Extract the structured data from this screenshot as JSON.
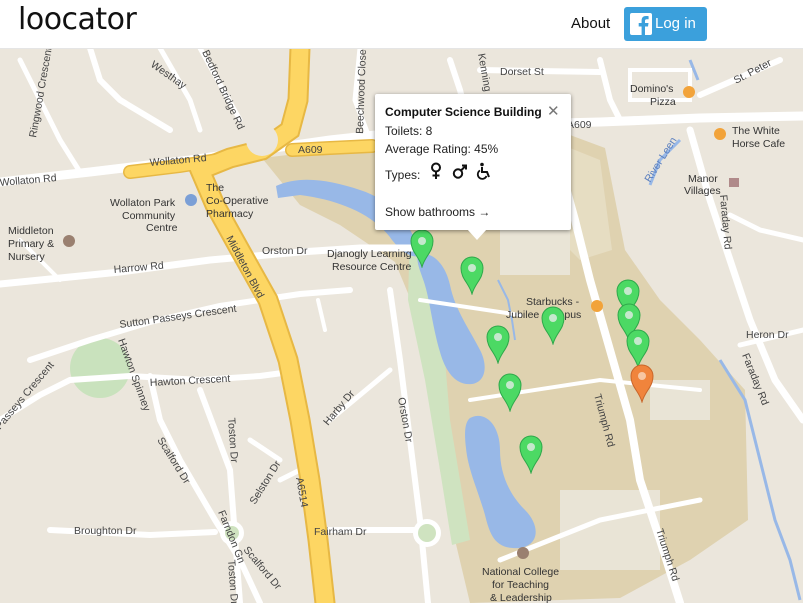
{
  "header": {
    "logo": "loocator",
    "about_label": "About",
    "login_label": "Log in",
    "facebook_glyph": "f"
  },
  "popup": {
    "title": "Computer Science Building",
    "close_glyph": "✕",
    "toilets_text": "Toilets: 8",
    "rating_text": "Average Rating: 45%",
    "types_label": "Types:",
    "types": [
      "female-icon",
      "male-icon",
      "wheelchair-icon"
    ],
    "link_text": "Show bathrooms →"
  },
  "markers": {
    "colors": {
      "default": "#4cd964",
      "selected": "#f0843c"
    },
    "count": 11
  },
  "map": {
    "roads": {
      "westhay": "Westhay",
      "bedford_bridge": "Bedford Bridge Rd",
      "ringwood": "Ringwood Crescent",
      "beechwood": "Beechwood Close",
      "kenmore": "Kenning",
      "dorset": "Dorset St",
      "st_peter": "St. Peter",
      "a609_right": "A609",
      "wollaton_rd_1": "Wollaton Rd",
      "wollaton_rd_2": "Wollaton Rd",
      "a609_left": "A609",
      "middleton_blvd": "Middleton Blvd",
      "orston_dr_1": "Orston Dr",
      "harrow_rd": "Harrow Rd",
      "sutton_passeys": "Sutton Passeys Crescent",
      "hawton_spinney": "Hawton Spinney",
      "hawton_crescent": "Hawton Crescent",
      "passeys_crescent": "Passeys Crescent",
      "harby_dr": "Harby Dr",
      "orston_dr_2": "Orston Dr",
      "scalford_dr_1": "Scalford Dr",
      "toston_dr_1": "Toston Dr",
      "selston_dr": "Selston Dr",
      "a6514": "A6514",
      "broughton_dr": "Broughton Dr",
      "fairham_dr": "Fairham Dr",
      "farndon_gn": "Farndon Gn",
      "scalford_dr_2": "Scalford Dr",
      "toston_dr_2": "Toston Dr",
      "triumph_rd_1": "Triumph Rd",
      "triumph_rd_2": "Triumph Rd",
      "faraday_rd_1": "Faraday Rd",
      "faraday_rd_2": "Faraday Rd",
      "heron_dr": "Heron Dr",
      "river_leen": "River Leen"
    },
    "pois": {
      "dominos": [
        "Domino's",
        "Pizza"
      ],
      "white_horse": [
        "The White",
        "Horse Cafe"
      ],
      "manor_villages": [
        "Manor",
        "Villages"
      ],
      "wollaton_park_school": [
        "Wollaton Park",
        "Community",
        "Centre"
      ],
      "middleton_school": [
        "Middleton",
        "Primary &",
        "Nursery"
      ],
      "coop": [
        "The",
        "Co-Operative",
        "Pharmacy"
      ],
      "djanogly": [
        "Djanogly Learning",
        "Resource Centre"
      ],
      "starbucks": [
        "Starbucks -",
        "Jubilee Campus"
      ],
      "national_college": [
        "National College",
        "for Teaching",
        "& Leadership"
      ]
    }
  }
}
